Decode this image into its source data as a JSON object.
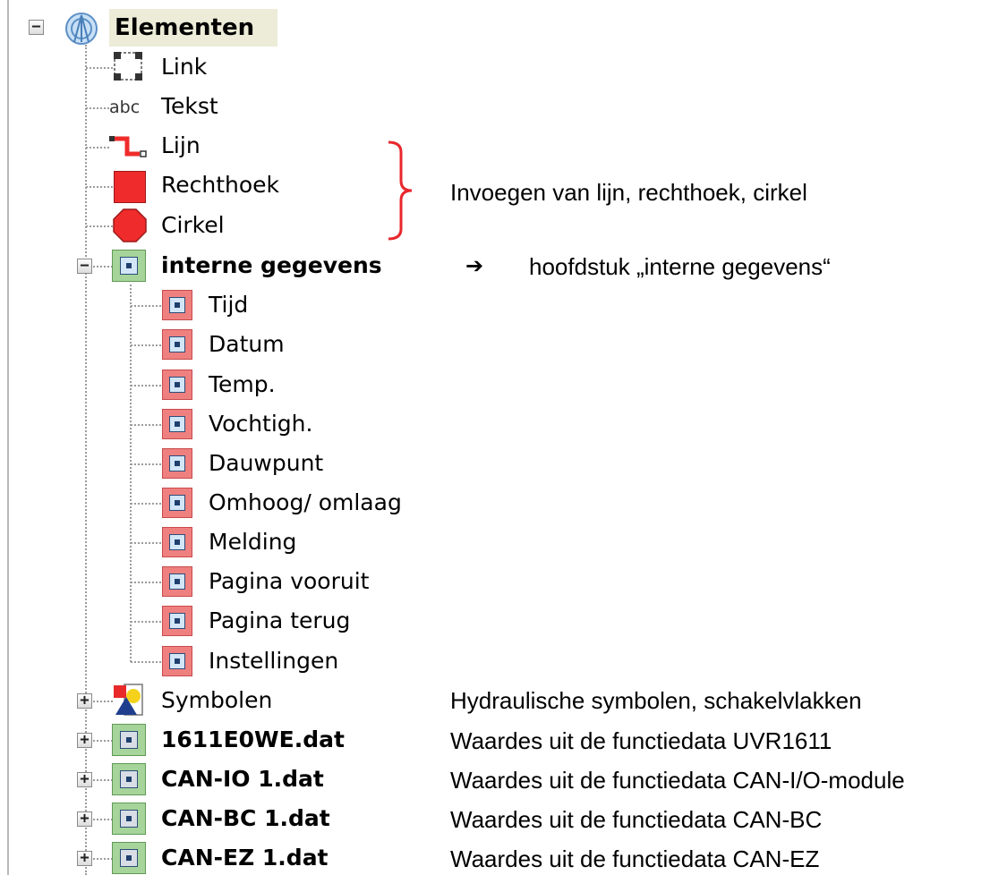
{
  "tree": {
    "root": {
      "label": "Elementen",
      "expander": "⊟"
    },
    "elements": [
      {
        "label": "Link"
      },
      {
        "label": "Tekst",
        "icon_text": "abc"
      },
      {
        "label": "Lijn"
      },
      {
        "label": "Rechthoek"
      },
      {
        "label": "Cirkel"
      }
    ],
    "interne": {
      "label": "interne gegevens",
      "expander": "−",
      "children": [
        {
          "label": "Tijd"
        },
        {
          "label": "Datum"
        },
        {
          "label": "Temp."
        },
        {
          "label": "Vochtigh."
        },
        {
          "label": "Dauwpunt"
        },
        {
          "label": "Omhoog/ omlaag"
        },
        {
          "label": "Melding"
        },
        {
          "label": "Pagina vooruit"
        },
        {
          "label": "Pagina terug"
        },
        {
          "label": "Instellingen"
        }
      ]
    },
    "bottom": [
      {
        "label": "Symbolen",
        "expander": "+"
      },
      {
        "label": "1611E0WE.dat",
        "expander": "+"
      },
      {
        "label": "CAN-IO 1.dat",
        "expander": "+"
      },
      {
        "label": "CAN-BC 1.dat",
        "expander": "+"
      },
      {
        "label": "CAN-EZ 1.dat",
        "expander": "+"
      }
    ]
  },
  "annotations": {
    "shapes": "Invoegen van lijn, rechthoek, cirkel",
    "arrow": "➔",
    "interne": "hoofdstuk „interne gegevens“",
    "symbolen": "Hydraulische symbolen, schakelvlakken",
    "uvr": "Waardes uit de functiedata UVR1611",
    "canio": "Waardes uit de functiedata CAN-I/O-module",
    "canbc": "Waardes uit de functiedata CAN-BC",
    "canez": "Waardes uit de functiedata CAN-EZ"
  },
  "colors": {
    "bracket": "#e8272c",
    "shape_red": "#ef2b2b",
    "tree_line": "#9c9c9c",
    "root_highlight": "#ececd8"
  }
}
